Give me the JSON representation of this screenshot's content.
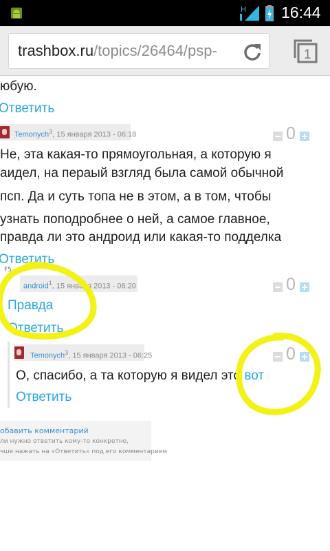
{
  "status_bar": {
    "time": "16:44",
    "network_label": "H",
    "icons": [
      "android-debug-icon",
      "signal-icon",
      "battery-icon"
    ]
  },
  "browser": {
    "url_host": "trashbox.ru",
    "url_path": "/topics/26464/psp-",
    "icons": [
      "refresh-icon",
      "tabs-icon"
    ],
    "tab_count": "1"
  },
  "content": {
    "fragment_text": "юбую.",
    "reply_label": "Ответить",
    "comments": [
      {
        "user": "Temonych",
        "user_sup": "3",
        "date": ", 15 января 2013 - 06:18",
        "score": "0",
        "lines": [
          "Не, эта какая-то прямоугольная, а которую я",
          "аидел, на пераый взгляд была самой обычной",
          "псп. Да и суть топа не в этом, а в том, чтобы",
          "узнать поподробнее о ней, а самое главное,",
          "правда ли это андроид или какая-то подделка"
        ]
      },
      {
        "label": "F5",
        "user": "android",
        "user_sup": "1",
        "date": ", 15 января 2013 - 06:20",
        "score": "0",
        "text": "Правда"
      },
      {
        "user": "Temonych",
        "user_sup": "3",
        "date": ", 15 января 2013 - 06:25",
        "score": "0",
        "text": "О, спасибо, а та которую я видел это ",
        "link_text": "вот"
      }
    ],
    "add_comment": {
      "title": "обавить комментарий",
      "hint_line1": "ли нужно ответить кому-то конкретно,",
      "hint_line2": "чше нажать на «Ответить» под его комментарием"
    }
  },
  "colors": {
    "link": "#27a7e1",
    "highlight": "#f2f217",
    "status_bar": "#000000",
    "toolbar": "#ececec"
  }
}
